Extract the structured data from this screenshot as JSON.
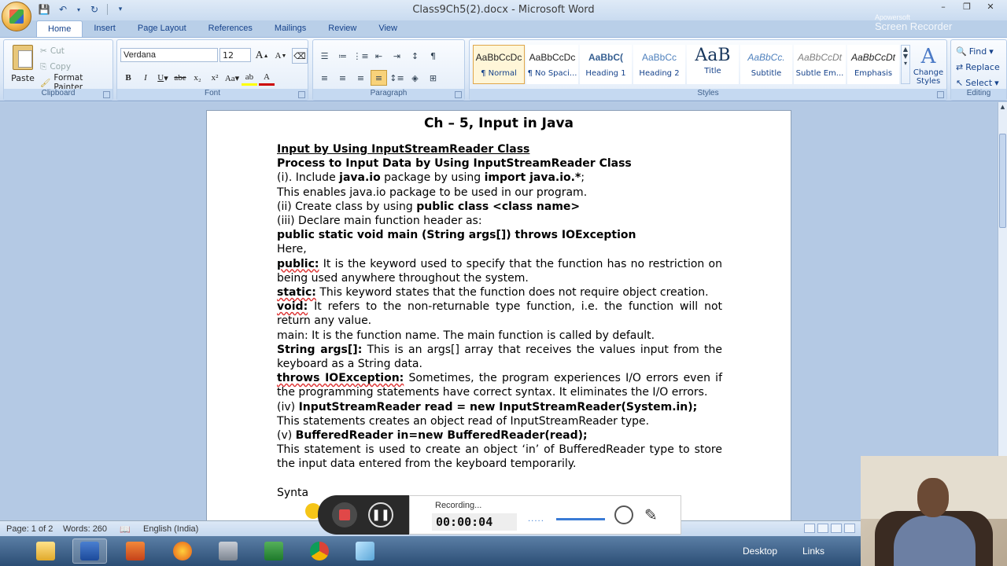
{
  "window": {
    "title": "Class9Ch5(2).docx - Microsoft Word",
    "controls": [
      "–",
      "❐",
      "✕"
    ]
  },
  "watermark": {
    "line1": "Apowersoft",
    "line2": "Screen Recorder"
  },
  "ribbon": {
    "tabs": [
      "Home",
      "Insert",
      "Page Layout",
      "References",
      "Mailings",
      "Review",
      "View"
    ],
    "active_tab": "Home",
    "clipboard": {
      "label": "Clipboard",
      "paste": "Paste",
      "cut": "Cut",
      "copy": "Copy",
      "format_painter": "Format Painter"
    },
    "font": {
      "label": "Font",
      "name": "Verdana",
      "size": "12"
    },
    "paragraph": {
      "label": "Paragraph"
    },
    "styles": {
      "label": "Styles",
      "items": [
        {
          "sample": "AaBbCcDc",
          "name": "¶ Normal"
        },
        {
          "sample": "AaBbCcDc",
          "name": "¶ No Spaci..."
        },
        {
          "sample": "AaBbC(",
          "name": "Heading 1"
        },
        {
          "sample": "AaBbCc",
          "name": "Heading 2"
        },
        {
          "sample": "AaB",
          "name": "Title"
        },
        {
          "sample": "AaBbCc.",
          "name": "Subtitle"
        },
        {
          "sample": "AaBbCcDt",
          "name": "Subtle Em..."
        },
        {
          "sample": "AaBbCcDt",
          "name": "Emphasis"
        }
      ],
      "change_styles": "Change Styles"
    },
    "editing": {
      "label": "Editing",
      "find": "Find",
      "replace": "Replace",
      "select": "Select"
    }
  },
  "document": {
    "title": "Ch – 5, Input in Java",
    "heading1": "Input by Using InputStreamReader Class",
    "heading2": "Process to Input Data by Using InputStreamReader Class",
    "l1a": "(i). Include ",
    "l1b": "java.io",
    "l1c": " package by using ",
    "l1d": "import java.io.*",
    "l1e": ";",
    "l2": "This enables java.io package to be used in our program.",
    "l3a": "(ii) Create class by using ",
    "l3b": "public class <class name>",
    "l4": "(iii) Declare main function header as:",
    "l5": "public static void main (String args[]) throws IOException",
    "l6": "Here,",
    "p_public_k": "public:",
    "p_public_t": " It is the keyword used to specify that the function has no restriction on being used anywhere throughout the system.",
    "p_static_k": "static:",
    "p_static_t": " This keyword states that the function does not require object creation.",
    "p_void_k": "void:",
    "p_void_t": " It refers to the non-returnable type function, i.e. the function will not return any value.",
    "p_main": "main: It is the function name. The main function is called by default.",
    "p_args_k": "String args[]:",
    "p_args_t": " This is an args[] array that receives the values input from the keyboard as a String data.",
    "p_throws_k": "throws IOException:",
    "p_throws_t": " Sometimes, the program experiences I/O errors even if the programming statements have correct syntax. It eliminates the I/O errors.",
    "l_iv_a": "(iv) ",
    "l_iv_b": "InputStreamReader read = new InputStreamReader(System.in);",
    "l_iv_2": "This statements creates an object read of InputStreamReader type.",
    "l_v_a": "(v) ",
    "l_v_b": "BufferedReader in=new BufferedReader(read);",
    "l_v_2": "This statement is used to create an object ‘in’ of BufferedReader type to store the input data entered from the keyboard temporarily.",
    "l_syntax": "Synta"
  },
  "statusbar": {
    "page": "Page: 1 of 2",
    "words": "Words: 260",
    "language": "English (India)"
  },
  "taskbar": {
    "desktop": "Desktop",
    "links": "Links"
  },
  "recorder": {
    "status": "Recording...",
    "time": "00:00:04"
  }
}
